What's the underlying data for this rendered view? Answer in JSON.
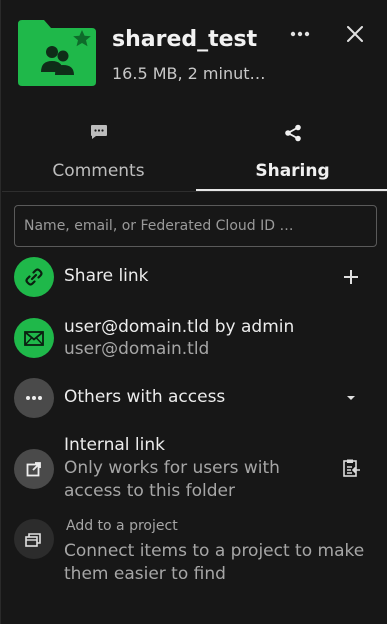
{
  "header": {
    "title": "shared_test",
    "subtitle": "16.5 MB, 2 minut…",
    "folder_color": "#1fb84a",
    "star_color": "#0e6b2a"
  },
  "tabs": [
    {
      "label": "Comments",
      "icon": "comment-icon",
      "active": false
    },
    {
      "label": "Sharing",
      "icon": "share-icon",
      "active": true
    }
  ],
  "search": {
    "placeholder": "Name, email, or Federated Cloud ID …"
  },
  "share_link": {
    "label": "Share link",
    "icon": "link-icon",
    "action_icon": "plus-icon"
  },
  "email_share": {
    "title": "user@domain.tld by admin",
    "subtitle": "user@domain.tld",
    "icon": "mail-icon"
  },
  "others": {
    "label": "Others with access",
    "icon": "dots-icon",
    "action_icon": "caret-down-icon"
  },
  "internal_link": {
    "title": "Internal link",
    "subtitle_line1": "Only works for users with",
    "subtitle_line2": "access to this folder",
    "icon": "external-link-icon",
    "action_icon": "clipboard-icon"
  },
  "project": {
    "label": "Add to a project",
    "desc_line1": "Connect items to a project to make",
    "desc_line2": "them easier to find",
    "icon": "projects-icon"
  },
  "colors": {
    "accent_green": "#1fb84a",
    "background": "#171717"
  }
}
